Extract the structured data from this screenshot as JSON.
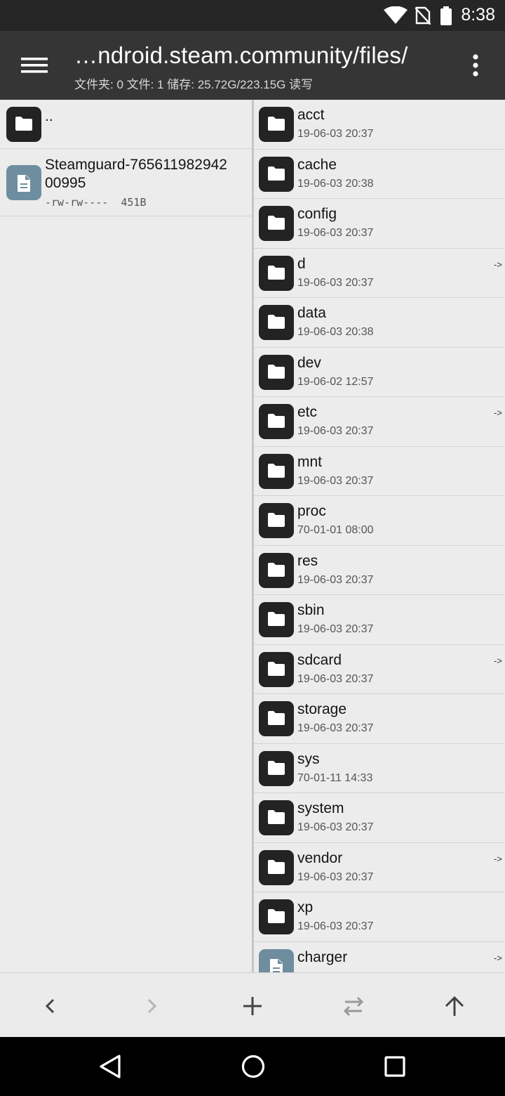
{
  "status_bar": {
    "time": "8:38",
    "icons": [
      "wifi-icon",
      "no-sim-icon",
      "battery-icon"
    ]
  },
  "app_bar": {
    "title": "…ndroid.steam.community/files/",
    "subtitle": "文件夹: 0  文件: 1  储存: 25.72G/223.15G  读写",
    "icons": [
      "hamburger-menu-icon",
      "more-vert-icon"
    ]
  },
  "left_pane": {
    "parent_label": "..",
    "file": {
      "name_line1": "Steamguard-765611982942",
      "name_line2": "00995",
      "perms": "-rw-rw----  451B"
    }
  },
  "right_pane": {
    "items": [
      {
        "name": "acct",
        "date": "19-06-03 20:37",
        "link": "",
        "type": "folder"
      },
      {
        "name": "cache",
        "date": "19-06-03 20:38",
        "link": "",
        "type": "folder"
      },
      {
        "name": "config",
        "date": "19-06-03 20:37",
        "link": "",
        "type": "folder"
      },
      {
        "name": "d",
        "date": "19-06-03 20:37",
        "link": "->",
        "type": "folder"
      },
      {
        "name": "data",
        "date": "19-06-03 20:38",
        "link": "",
        "type": "folder"
      },
      {
        "name": "dev",
        "date": "19-06-02 12:57",
        "link": "",
        "type": "folder"
      },
      {
        "name": "etc",
        "date": "19-06-03 20:37",
        "link": "->",
        "type": "folder"
      },
      {
        "name": "mnt",
        "date": "19-06-03 20:37",
        "link": "",
        "type": "folder"
      },
      {
        "name": "proc",
        "date": "70-01-01 08:00",
        "link": "",
        "type": "folder"
      },
      {
        "name": "res",
        "date": "19-06-03 20:37",
        "link": "",
        "type": "folder"
      },
      {
        "name": "sbin",
        "date": "19-06-03 20:37",
        "link": "",
        "type": "folder"
      },
      {
        "name": "sdcard",
        "date": "19-06-03 20:37",
        "link": "->",
        "type": "folder"
      },
      {
        "name": "storage",
        "date": "19-06-03 20:37",
        "link": "",
        "type": "folder"
      },
      {
        "name": "sys",
        "date": "70-01-11 14:33",
        "link": "",
        "type": "folder"
      },
      {
        "name": "system",
        "date": "19-06-03 20:37",
        "link": "",
        "type": "folder"
      },
      {
        "name": "vendor",
        "date": "19-06-03 20:37",
        "link": "->",
        "type": "folder"
      },
      {
        "name": "xp",
        "date": "19-06-03 20:37",
        "link": "",
        "type": "folder"
      },
      {
        "name": "charger",
        "date": "",
        "link": "->",
        "type": "file"
      }
    ]
  },
  "bottom_bar": {
    "icons": [
      "back-arrow-icon",
      "forward-arrow-icon",
      "add-icon",
      "swap-panes-icon",
      "up-arrow-icon"
    ]
  },
  "nav_bar": {
    "icons": [
      "nav-back-icon",
      "nav-home-icon",
      "nav-recents-icon"
    ]
  },
  "colors": {
    "app_bar": "#353535",
    "status_bar": "#262626",
    "folder_icon": "#232323",
    "file_icon": "#6e8ea0"
  }
}
